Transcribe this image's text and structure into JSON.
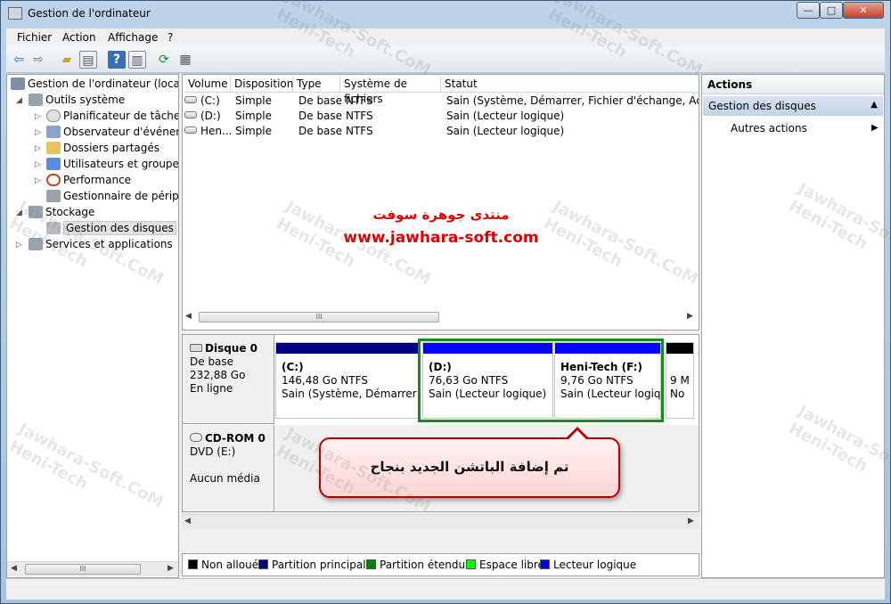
{
  "window": {
    "title": "Gestion de l'ordinateur",
    "btn_min": "—",
    "btn_max": "□",
    "btn_close": "✕"
  },
  "menu": {
    "items": [
      "Fichier",
      "Action",
      "Affichage",
      "?"
    ]
  },
  "toolbar": {
    "icons": [
      "back-arrow-icon",
      "forward-arrow-icon",
      "folder-up-icon",
      "console-tree-icon",
      "help-icon",
      "properties-icon",
      "refresh-icon",
      "export-icon"
    ]
  },
  "tree": {
    "root": "Gestion de l'ordinateur (local)",
    "outils": "Outils système",
    "planificateur": "Planificateur de tâches",
    "observateur": "Observateur d'événeme",
    "dossiers": "Dossiers partagés",
    "utilisateurs": "Utilisateurs et groupes l",
    "performance": "Performance",
    "gestionnaire": "Gestionnaire de périphé",
    "stockage": "Stockage",
    "gestion_disques": "Gestion des disques",
    "services": "Services et applications"
  },
  "volumes": {
    "headers": [
      "Volume",
      "Disposition",
      "Type",
      "Système de fichiers",
      "Statut"
    ],
    "rows": [
      {
        "volume": "(C:)",
        "disposition": "Simple",
        "type": "De base",
        "fs": "NTFS",
        "status": "Sain (Système, Démarrer, Fichier d'échange, Actif, Vid"
      },
      {
        "volume": "(D:)",
        "disposition": "Simple",
        "type": "De base",
        "fs": "NTFS",
        "status": "Sain (Lecteur logique)"
      },
      {
        "volume": "Hen...",
        "disposition": "Simple",
        "type": "De base",
        "fs": "NTFS",
        "status": "Sain (Lecteur logique)"
      }
    ]
  },
  "overlay": {
    "forum_arabic": "منتدى جوهرة سوفت",
    "forum_url": "www.jawhara-soft.com",
    "callout": "تم إضافة الباتشن الجديد بنجاح"
  },
  "disk0": {
    "name": "Disque 0",
    "type": "De base",
    "size": "232,88 Go",
    "state": "En ligne",
    "partitions": [
      {
        "label": "(C:)",
        "size": "146,48 Go NTFS",
        "status": "Sain (Système, Démarrer, Fi",
        "color": "#000080"
      },
      {
        "label": "(D:)",
        "size": "76,63 Go NTFS",
        "status": "Sain (Lecteur logique)",
        "color": "#0000ff"
      },
      {
        "label": "Heni-Tech  (F:)",
        "size": "9,76 Go NTFS",
        "status": "Sain (Lecteur logiqu",
        "color": "#0000ff"
      },
      {
        "label": "9 M",
        "size": "No",
        "status": "",
        "color": "#000000"
      }
    ]
  },
  "cdrom0": {
    "name": "CD-ROM 0",
    "type": "DVD (E:)",
    "media": "Aucun média"
  },
  "legend": [
    {
      "label": "Non alloué",
      "color": "#000000"
    },
    {
      "label": "Partition principale",
      "color": "#000080"
    },
    {
      "label": "Partition étendue",
      "color": "#008000"
    },
    {
      "label": "Espace libre",
      "color": "#00ff00"
    },
    {
      "label": "Lecteur logique",
      "color": "#0000ff"
    }
  ],
  "actions": {
    "header": "Actions",
    "section": "Gestion des disques",
    "item": "Autres actions"
  },
  "watermark": {
    "line1": "Jawhara-Soft.CoM",
    "line2": "Heni-Tech"
  },
  "scroll": {
    "grip": "III"
  }
}
